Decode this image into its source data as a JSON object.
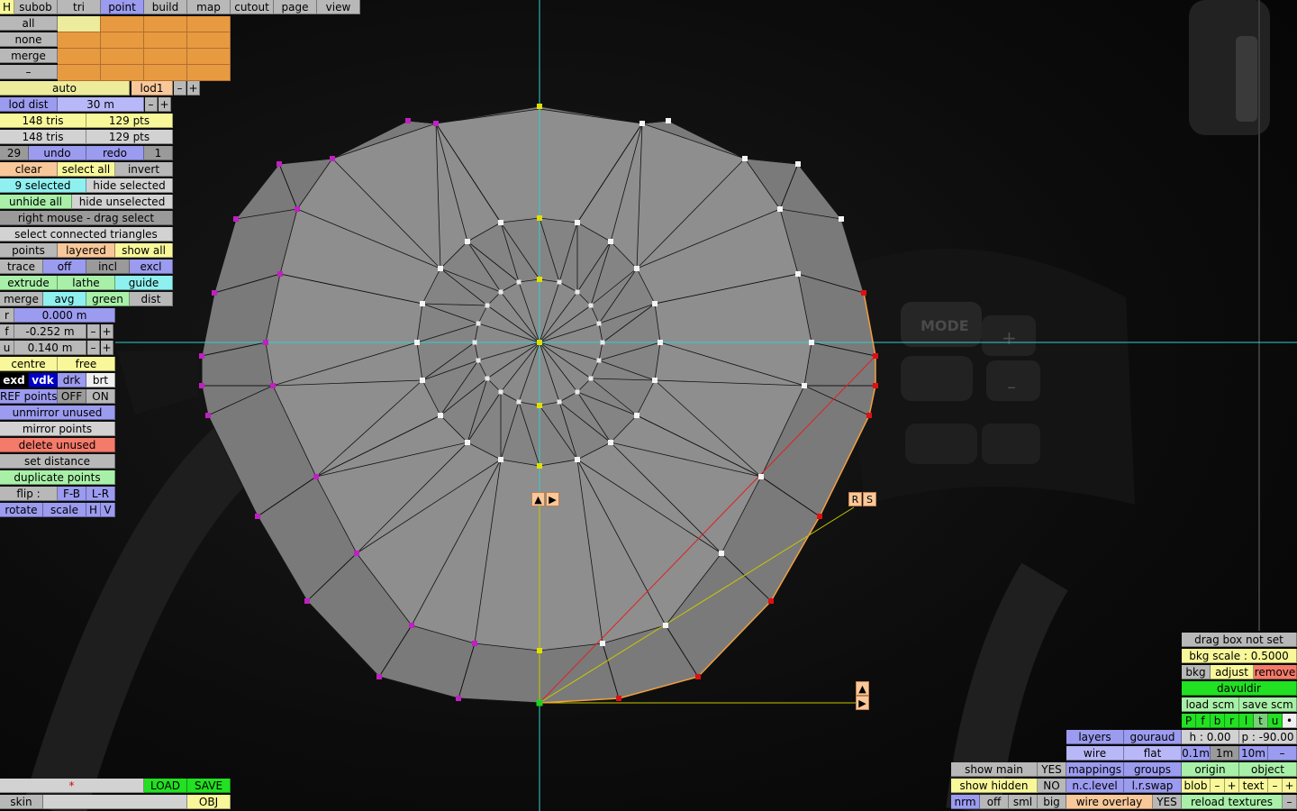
{
  "top_tabs": [
    "H",
    "subob",
    "tri",
    "point",
    "build",
    "map",
    "cutout",
    "page",
    "view"
  ],
  "select_rows": [
    "all",
    "none",
    "merge",
    "–"
  ],
  "lod": {
    "auto": "auto",
    "lod1": "lod1",
    "minus": "–",
    "plus": "+",
    "dist_label": "lod dist",
    "dist_value": "30 m"
  },
  "stats": {
    "tris1": "148 tris",
    "pts1": "129 pts",
    "tris2": "148 tris",
    "pts2": "129 pts"
  },
  "undo_row": {
    "count": "29",
    "undo": "undo",
    "redo": "redo",
    "num": "1"
  },
  "sel_row": {
    "clear": "clear",
    "select_all": "select all",
    "invert": "invert"
  },
  "hide_row": {
    "selected": "9 selected",
    "hide_selected": "hide selected"
  },
  "unhide_row": {
    "unhide_all": "unhide all",
    "hide_unselected": "hide unselected"
  },
  "right_mouse": "right mouse - drag select",
  "connected": "select connected triangles",
  "points_row": {
    "points": "points",
    "layered": "layered",
    "show_all": "show all"
  },
  "trace_row": {
    "trace": "trace",
    "off": "off",
    "incl": "incl",
    "excl": "excl"
  },
  "extrude_row": {
    "extrude": "extrude",
    "lathe": "lathe",
    "guide": "guide"
  },
  "merge_row": {
    "merge": "merge",
    "avg": "avg",
    "green": "green",
    "dist": "dist"
  },
  "coords": {
    "r_label": "r",
    "r_value": "0.000 m",
    "f_label": "f",
    "f_value": "-0.252 m",
    "u_label": "u",
    "u_value": "0.140 m",
    "minus": "–",
    "plus": "+"
  },
  "centre_row": {
    "centre": "centre",
    "free": "free"
  },
  "view_row": {
    "exd": "exd",
    "vdk": "vdk",
    "drk": "drk",
    "brt": "brt"
  },
  "ref_row": {
    "ref": "REF points",
    "off": "OFF",
    "on": "ON"
  },
  "actions": {
    "unmirror": "unmirror unused",
    "mirror": "mirror points",
    "delete": "delete unused",
    "setdist": "set distance",
    "duplicate": "duplicate points"
  },
  "flip_row": {
    "flip": "flip :",
    "fb": "F-B",
    "lr": "L-R"
  },
  "rotate_row": {
    "rotate": "rotate",
    "scale": "scale",
    "h": "H",
    "v": "V"
  },
  "bottom_left": {
    "star": "*",
    "load": "LOAD",
    "save": "SAVE",
    "skin": "skin",
    "obj": "OBJ"
  },
  "right_panel": {
    "drag_box": "drag box not set",
    "bkg_scale": "bkg scale : 0.5000",
    "bkg": "bkg",
    "adjust": "adjust",
    "remove": "remove",
    "name": "davuldir",
    "load_scm": "load scm",
    "save_scm": "save scm",
    "letters": [
      "P",
      "f",
      "b",
      "r",
      "l",
      "t",
      "u",
      "•"
    ],
    "h": "h : 0.00",
    "p": "p : -90.00",
    "m01": "0.1m",
    "m1": "1m",
    "m10": "10m",
    "mminus": "–",
    "origin": "origin",
    "object": "object",
    "blob": "blob",
    "text": "text",
    "pm_minus": "–",
    "pm_plus": "+",
    "reload": "reload textures",
    "reload_minus": "–"
  },
  "mid_panel": {
    "layers": "layers",
    "gouraud": "gouraud",
    "wire": "wire",
    "flat": "flat",
    "mappings": "mappings",
    "groups": "groups",
    "n_c_level": "n.c.level",
    "l_r_swap": "l.r.swap",
    "wire_overlay": "wire overlay",
    "yes": "YES"
  },
  "left_panel2": {
    "show_main": "show main",
    "yes": "YES",
    "show_hidden": "show hidden",
    "no": "NO",
    "nrm": "nrm",
    "off": "off",
    "sml": "sml",
    "big": "big"
  },
  "viewport": {
    "rs_r": "R",
    "rs_s": "S",
    "up_arrow": "▲",
    "right_arrow": "▶",
    "bg_labels": [
      "MODE",
      "+",
      "–"
    ],
    "axis_color": "#30d0d0",
    "mesh_color": "#8c8c8c"
  }
}
